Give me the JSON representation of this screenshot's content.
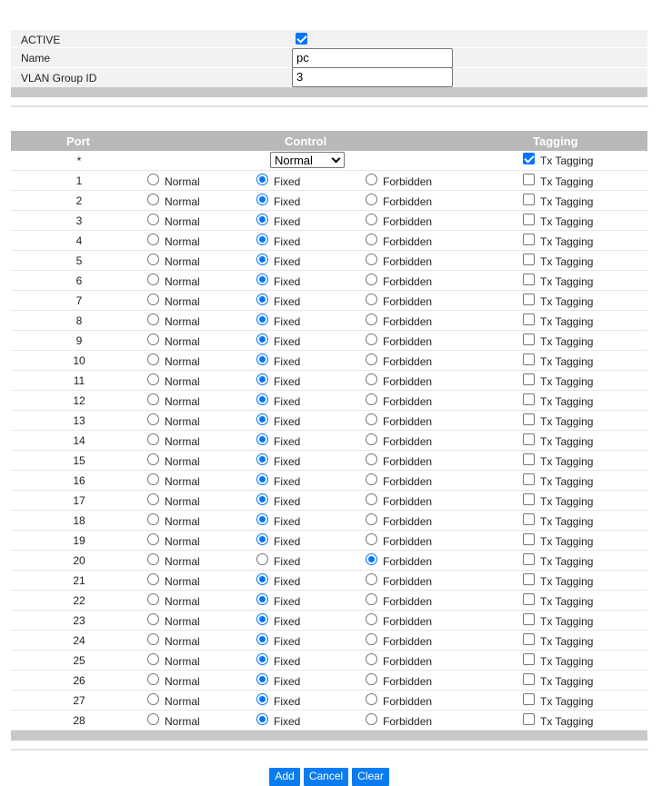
{
  "form": {
    "active_label": "ACTIVE",
    "active_checked": true,
    "name_label": "Name",
    "name_value": "pc",
    "vlan_group_label": "VLAN Group ID",
    "vlan_group_value": "3"
  },
  "table": {
    "headers": {
      "port": "Port",
      "control": "Control",
      "tagging": "Tagging"
    },
    "all_row": {
      "port": "*",
      "control_select": "Normal",
      "tagging_label": "Tx Tagging",
      "tagging_checked": true
    },
    "option_labels": {
      "normal": "Normal",
      "fixed": "Fixed",
      "forbidden": "Forbidden",
      "tx_tagging": "Tx Tagging"
    },
    "rows": [
      {
        "port": "1",
        "control": "fixed",
        "tx_tagging": false
      },
      {
        "port": "2",
        "control": "fixed",
        "tx_tagging": false
      },
      {
        "port": "3",
        "control": "fixed",
        "tx_tagging": false
      },
      {
        "port": "4",
        "control": "fixed",
        "tx_tagging": false
      },
      {
        "port": "5",
        "control": "fixed",
        "tx_tagging": false
      },
      {
        "port": "6",
        "control": "fixed",
        "tx_tagging": false
      },
      {
        "port": "7",
        "control": "fixed",
        "tx_tagging": false
      },
      {
        "port": "8",
        "control": "fixed",
        "tx_tagging": false
      },
      {
        "port": "9",
        "control": "fixed",
        "tx_tagging": false
      },
      {
        "port": "10",
        "control": "fixed",
        "tx_tagging": false
      },
      {
        "port": "11",
        "control": "fixed",
        "tx_tagging": false
      },
      {
        "port": "12",
        "control": "fixed",
        "tx_tagging": false
      },
      {
        "port": "13",
        "control": "fixed",
        "tx_tagging": false
      },
      {
        "port": "14",
        "control": "fixed",
        "tx_tagging": false
      },
      {
        "port": "15",
        "control": "fixed",
        "tx_tagging": false
      },
      {
        "port": "16",
        "control": "fixed",
        "tx_tagging": false
      },
      {
        "port": "17",
        "control": "fixed",
        "tx_tagging": false
      },
      {
        "port": "18",
        "control": "fixed",
        "tx_tagging": false
      },
      {
        "port": "19",
        "control": "fixed",
        "tx_tagging": false
      },
      {
        "port": "20",
        "control": "forbidden",
        "tx_tagging": false
      },
      {
        "port": "21",
        "control": "fixed",
        "tx_tagging": false
      },
      {
        "port": "22",
        "control": "fixed",
        "tx_tagging": false
      },
      {
        "port": "23",
        "control": "fixed",
        "tx_tagging": false
      },
      {
        "port": "24",
        "control": "fixed",
        "tx_tagging": false
      },
      {
        "port": "25",
        "control": "fixed",
        "tx_tagging": false
      },
      {
        "port": "26",
        "control": "fixed",
        "tx_tagging": false
      },
      {
        "port": "27",
        "control": "fixed",
        "tx_tagging": false
      },
      {
        "port": "28",
        "control": "fixed",
        "tx_tagging": false
      }
    ]
  },
  "buttons": {
    "add": "Add",
    "cancel": "Cancel",
    "clear": "Clear"
  },
  "colors": {
    "accent": "#0075ff",
    "button": "#0a7cf0",
    "header_bg": "#b8b8b8",
    "form_bg": "#f2f2f2"
  }
}
